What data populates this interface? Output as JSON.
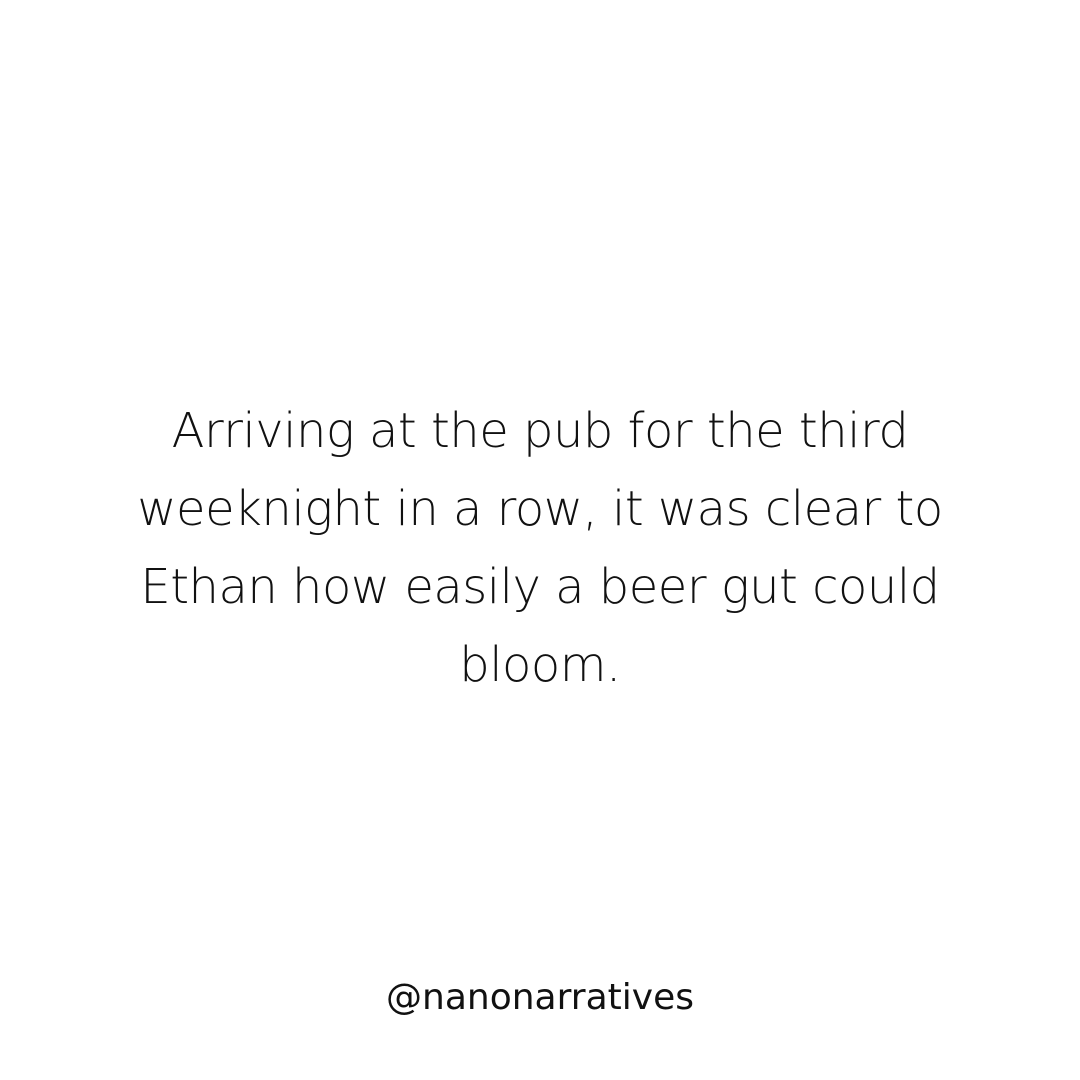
{
  "post": {
    "story_lines": [
      "Arriving at the pub for the third",
      "weeknight in a row, it was clear to",
      "Ethan how easily a beer gut could",
      "bloom."
    ],
    "handle": "@nanonarratives"
  },
  "colors": {
    "background": "#ffffff",
    "text": "#111111"
  }
}
